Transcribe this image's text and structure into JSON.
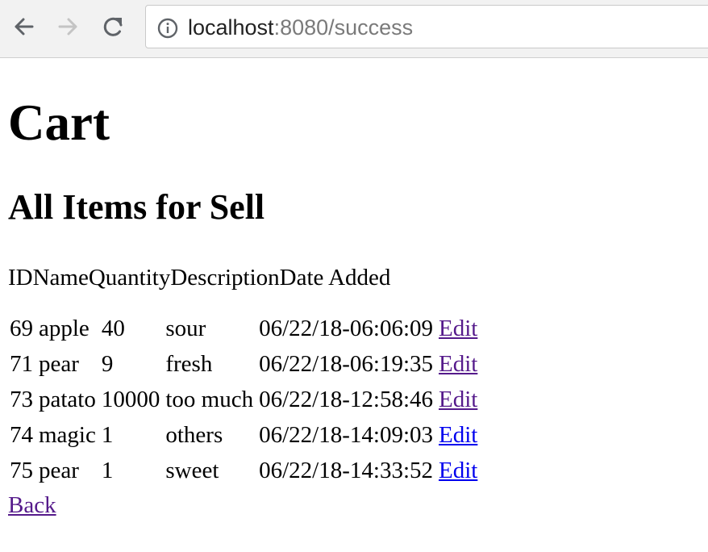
{
  "browser": {
    "url_host": "localhost",
    "url_path": ":8080/success"
  },
  "page": {
    "title": "Cart",
    "subtitle": "All Items for Sell",
    "columns": [
      "ID",
      "Name",
      "Quantity",
      "Description",
      "Date Added"
    ],
    "rows": [
      {
        "id": "69",
        "name": "apple",
        "quantity": "40",
        "description": "sour",
        "date": "06/22/18-06:06:09",
        "action": "Edit",
        "visited": true
      },
      {
        "id": "71",
        "name": "pear",
        "quantity": "9",
        "description": "fresh",
        "date": "06/22/18-06:19:35",
        "action": "Edit",
        "visited": true
      },
      {
        "id": "73",
        "name": "patato",
        "quantity": "10000",
        "description": "too much",
        "date": "06/22/18-12:58:46",
        "action": "Edit",
        "visited": true
      },
      {
        "id": "74",
        "name": "magic",
        "quantity": "1",
        "description": "others",
        "date": "06/22/18-14:09:03",
        "action": "Edit",
        "visited": false
      },
      {
        "id": "75",
        "name": "pear",
        "quantity": "1",
        "description": "sweet",
        "date": "06/22/18-14:33:52",
        "action": "Edit",
        "visited": false
      }
    ],
    "back_label": "Back"
  },
  "colors": {
    "link": "#0000ee",
    "visited_link": "#551a8b"
  },
  "icons": {
    "back": "arrow-left-icon",
    "forward": "arrow-right-icon",
    "reload": "reload-icon",
    "info": "info-icon"
  }
}
